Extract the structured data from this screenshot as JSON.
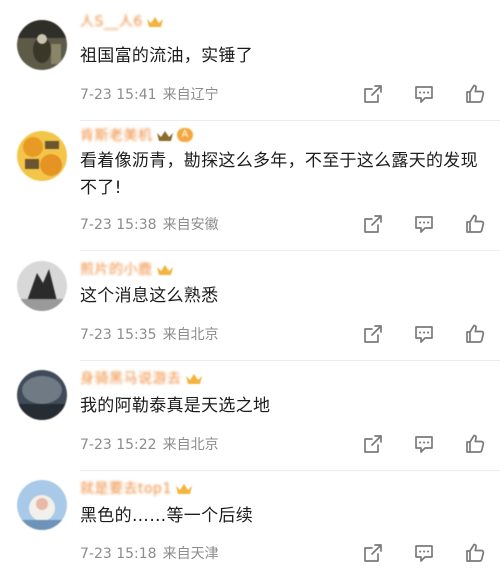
{
  "comments": [
    {
      "username": "人S__人6",
      "text": "祖国富的流油，实锤了",
      "time": "7-23 15:41",
      "location": "来自辽宁",
      "avatar_colors": [
        "#6b6650",
        "#3a3a30",
        "#c9c3b0"
      ],
      "has_level": false
    },
    {
      "username": "肯斯老美机",
      "level": "A",
      "text": "看着像沥青，勘探这么多年，不至于这么露天的发现不了!",
      "time": "7-23 15:38",
      "location": "来自安徽",
      "avatar_colors": [
        "#f5c445",
        "#e49a22",
        "#5d4a2c"
      ],
      "has_level": true
    },
    {
      "username": "煎片的小鹿",
      "text": "这个消息这么熟悉",
      "time": "7-23 15:35",
      "location": "来自北京",
      "avatar_colors": [
        "#d6d6d6",
        "#2b2b2b",
        "#8a8a8a"
      ],
      "has_level": false
    },
    {
      "username": "身骑黑马说游去",
      "text": "我的阿勒泰真是天选之地",
      "time": "7-23 15:22",
      "location": "来自北京",
      "avatar_colors": [
        "#4a5868",
        "#2c343d",
        "#a9b1b8"
      ],
      "has_level": false
    },
    {
      "username": "就是要去top1",
      "text": "黑色的……等一个后续",
      "time": "7-23 15:18",
      "location": "来自天津",
      "avatar_colors": [
        "#9fc1e3",
        "#f3f3f0",
        "#e7b9a6"
      ],
      "has_level": false
    }
  ],
  "colors": {
    "username": "#f08c3c",
    "meta": "#8c8c8c",
    "icon": "#7a7a7a",
    "vip_crown": "#f3b53f"
  },
  "icons": [
    "share-icon",
    "comment-icon",
    "like-icon",
    "vip-crown-icon"
  ]
}
